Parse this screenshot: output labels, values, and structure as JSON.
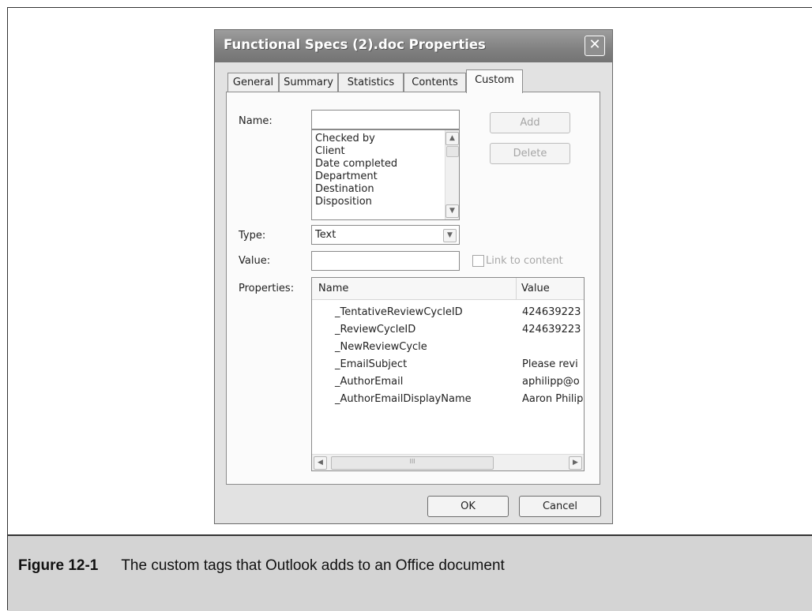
{
  "dialog": {
    "title": "Functional Specs (2).doc Properties",
    "close_glyph": "✕",
    "tabs": [
      {
        "label": "General"
      },
      {
        "label": "Summary"
      },
      {
        "label": "Statistics"
      },
      {
        "label": "Contents"
      },
      {
        "label": "Custom"
      }
    ],
    "active_tab": "Custom",
    "name_label": "Name:",
    "name_value": "",
    "name_options": [
      "Checked by",
      "Client",
      "Date completed",
      "Department",
      "Destination",
      "Disposition"
    ],
    "add_label": "Add",
    "delete_label": "Delete",
    "type_label": "Type:",
    "type_value": "Text",
    "value_label": "Value:",
    "value_value": "",
    "link_label": "Link to content",
    "properties_label": "Properties:",
    "properties_columns": [
      "Name",
      "Value"
    ],
    "properties_rows": [
      {
        "name": "_TentativeReviewCycleID",
        "value": "424639223"
      },
      {
        "name": "_ReviewCycleID",
        "value": "424639223"
      },
      {
        "name": "_NewReviewCycle",
        "value": ""
      },
      {
        "name": "_EmailSubject",
        "value": "Please revi"
      },
      {
        "name": "_AuthorEmail",
        "value": "aphilipp@o"
      },
      {
        "name": "_AuthorEmailDisplayName",
        "value": "Aaron Philip"
      }
    ],
    "hscroll_grip": "III",
    "ok_label": "OK",
    "cancel_label": "Cancel"
  },
  "caption": {
    "number": "Figure 12-1",
    "text": "The custom tags that Outlook adds to an Office document"
  },
  "colors": {
    "titlebar": "#808080",
    "dialog_bg": "#e2e2e2",
    "panel_bg": "#fbfbfb",
    "caption_bg": "#d4d4d4"
  },
  "icons": {
    "close": "close-icon",
    "scroll_up": "chevron-up-icon",
    "scroll_down": "chevron-down-icon",
    "dropdown": "chevron-down-icon",
    "scroll_left": "chevron-left-icon",
    "scroll_right": "chevron-right-icon"
  }
}
